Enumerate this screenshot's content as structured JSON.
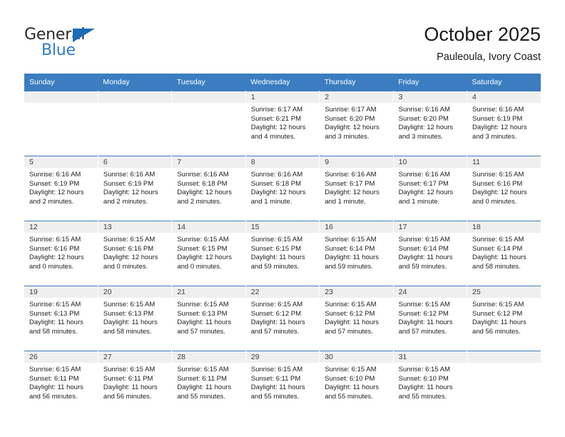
{
  "brand": {
    "name_top": "General",
    "name_bottom": "Blue",
    "triangle_color": "#1b6cb5",
    "text_color": "#2d7dc4"
  },
  "header": {
    "title": "October 2025",
    "subtitle": "Pauleoula, Ivory Coast"
  },
  "theme": {
    "header_bg": "#3b7dc0",
    "header_text": "#ffffff",
    "daynum_bg": "#efefef",
    "cell_bg": "#ffffff",
    "grid_line": "#3b7dc0"
  },
  "weekdays": [
    "Sunday",
    "Monday",
    "Tuesday",
    "Wednesday",
    "Thursday",
    "Friday",
    "Saturday"
  ],
  "labels": {
    "sunrise_prefix": "Sunrise:",
    "sunset_prefix": "Sunset:",
    "daylight_prefix": "Daylight:"
  },
  "weeks": [
    [
      {
        "day": "",
        "empty": true
      },
      {
        "day": "",
        "empty": true
      },
      {
        "day": "",
        "empty": true
      },
      {
        "day": "1",
        "sunrise": "Sunrise: 6:17 AM",
        "sunset": "Sunset: 6:21 PM",
        "daylight_1": "Daylight: 12 hours",
        "daylight_2": "and 4 minutes."
      },
      {
        "day": "2",
        "sunrise": "Sunrise: 6:17 AM",
        "sunset": "Sunset: 6:20 PM",
        "daylight_1": "Daylight: 12 hours",
        "daylight_2": "and 3 minutes."
      },
      {
        "day": "3",
        "sunrise": "Sunrise: 6:16 AM",
        "sunset": "Sunset: 6:20 PM",
        "daylight_1": "Daylight: 12 hours",
        "daylight_2": "and 3 minutes."
      },
      {
        "day": "4",
        "sunrise": "Sunrise: 6:16 AM",
        "sunset": "Sunset: 6:19 PM",
        "daylight_1": "Daylight: 12 hours",
        "daylight_2": "and 3 minutes."
      }
    ],
    [
      {
        "day": "5",
        "sunrise": "Sunrise: 6:16 AM",
        "sunset": "Sunset: 6:19 PM",
        "daylight_1": "Daylight: 12 hours",
        "daylight_2": "and 2 minutes."
      },
      {
        "day": "6",
        "sunrise": "Sunrise: 6:16 AM",
        "sunset": "Sunset: 6:19 PM",
        "daylight_1": "Daylight: 12 hours",
        "daylight_2": "and 2 minutes."
      },
      {
        "day": "7",
        "sunrise": "Sunrise: 6:16 AM",
        "sunset": "Sunset: 6:18 PM",
        "daylight_1": "Daylight: 12 hours",
        "daylight_2": "and 2 minutes."
      },
      {
        "day": "8",
        "sunrise": "Sunrise: 6:16 AM",
        "sunset": "Sunset: 6:18 PM",
        "daylight_1": "Daylight: 12 hours",
        "daylight_2": "and 1 minute."
      },
      {
        "day": "9",
        "sunrise": "Sunrise: 6:16 AM",
        "sunset": "Sunset: 6:17 PM",
        "daylight_1": "Daylight: 12 hours",
        "daylight_2": "and 1 minute."
      },
      {
        "day": "10",
        "sunrise": "Sunrise: 6:16 AM",
        "sunset": "Sunset: 6:17 PM",
        "daylight_1": "Daylight: 12 hours",
        "daylight_2": "and 1 minute."
      },
      {
        "day": "11",
        "sunrise": "Sunrise: 6:15 AM",
        "sunset": "Sunset: 6:16 PM",
        "daylight_1": "Daylight: 12 hours",
        "daylight_2": "and 0 minutes."
      }
    ],
    [
      {
        "day": "12",
        "sunrise": "Sunrise: 6:15 AM",
        "sunset": "Sunset: 6:16 PM",
        "daylight_1": "Daylight: 12 hours",
        "daylight_2": "and 0 minutes."
      },
      {
        "day": "13",
        "sunrise": "Sunrise: 6:15 AM",
        "sunset": "Sunset: 6:16 PM",
        "daylight_1": "Daylight: 12 hours",
        "daylight_2": "and 0 minutes."
      },
      {
        "day": "14",
        "sunrise": "Sunrise: 6:15 AM",
        "sunset": "Sunset: 6:15 PM",
        "daylight_1": "Daylight: 12 hours",
        "daylight_2": "and 0 minutes."
      },
      {
        "day": "15",
        "sunrise": "Sunrise: 6:15 AM",
        "sunset": "Sunset: 6:15 PM",
        "daylight_1": "Daylight: 11 hours",
        "daylight_2": "and 59 minutes."
      },
      {
        "day": "16",
        "sunrise": "Sunrise: 6:15 AM",
        "sunset": "Sunset: 6:14 PM",
        "daylight_1": "Daylight: 11 hours",
        "daylight_2": "and 59 minutes."
      },
      {
        "day": "17",
        "sunrise": "Sunrise: 6:15 AM",
        "sunset": "Sunset: 6:14 PM",
        "daylight_1": "Daylight: 11 hours",
        "daylight_2": "and 59 minutes."
      },
      {
        "day": "18",
        "sunrise": "Sunrise: 6:15 AM",
        "sunset": "Sunset: 6:14 PM",
        "daylight_1": "Daylight: 11 hours",
        "daylight_2": "and 58 minutes."
      }
    ],
    [
      {
        "day": "19",
        "sunrise": "Sunrise: 6:15 AM",
        "sunset": "Sunset: 6:13 PM",
        "daylight_1": "Daylight: 11 hours",
        "daylight_2": "and 58 minutes."
      },
      {
        "day": "20",
        "sunrise": "Sunrise: 6:15 AM",
        "sunset": "Sunset: 6:13 PM",
        "daylight_1": "Daylight: 11 hours",
        "daylight_2": "and 58 minutes."
      },
      {
        "day": "21",
        "sunrise": "Sunrise: 6:15 AM",
        "sunset": "Sunset: 6:13 PM",
        "daylight_1": "Daylight: 11 hours",
        "daylight_2": "and 57 minutes."
      },
      {
        "day": "22",
        "sunrise": "Sunrise: 6:15 AM",
        "sunset": "Sunset: 6:12 PM",
        "daylight_1": "Daylight: 11 hours",
        "daylight_2": "and 57 minutes."
      },
      {
        "day": "23",
        "sunrise": "Sunrise: 6:15 AM",
        "sunset": "Sunset: 6:12 PM",
        "daylight_1": "Daylight: 11 hours",
        "daylight_2": "and 57 minutes."
      },
      {
        "day": "24",
        "sunrise": "Sunrise: 6:15 AM",
        "sunset": "Sunset: 6:12 PM",
        "daylight_1": "Daylight: 11 hours",
        "daylight_2": "and 57 minutes."
      },
      {
        "day": "25",
        "sunrise": "Sunrise: 6:15 AM",
        "sunset": "Sunset: 6:12 PM",
        "daylight_1": "Daylight: 11 hours",
        "daylight_2": "and 56 minutes."
      }
    ],
    [
      {
        "day": "26",
        "sunrise": "Sunrise: 6:15 AM",
        "sunset": "Sunset: 6:11 PM",
        "daylight_1": "Daylight: 11 hours",
        "daylight_2": "and 56 minutes."
      },
      {
        "day": "27",
        "sunrise": "Sunrise: 6:15 AM",
        "sunset": "Sunset: 6:11 PM",
        "daylight_1": "Daylight: 11 hours",
        "daylight_2": "and 56 minutes."
      },
      {
        "day": "28",
        "sunrise": "Sunrise: 6:15 AM",
        "sunset": "Sunset: 6:11 PM",
        "daylight_1": "Daylight: 11 hours",
        "daylight_2": "and 55 minutes."
      },
      {
        "day": "29",
        "sunrise": "Sunrise: 6:15 AM",
        "sunset": "Sunset: 6:11 PM",
        "daylight_1": "Daylight: 11 hours",
        "daylight_2": "and 55 minutes."
      },
      {
        "day": "30",
        "sunrise": "Sunrise: 6:15 AM",
        "sunset": "Sunset: 6:10 PM",
        "daylight_1": "Daylight: 11 hours",
        "daylight_2": "and 55 minutes."
      },
      {
        "day": "31",
        "sunrise": "Sunrise: 6:15 AM",
        "sunset": "Sunset: 6:10 PM",
        "daylight_1": "Daylight: 11 hours",
        "daylight_2": "and 55 minutes."
      },
      {
        "day": "",
        "empty": true
      }
    ]
  ]
}
